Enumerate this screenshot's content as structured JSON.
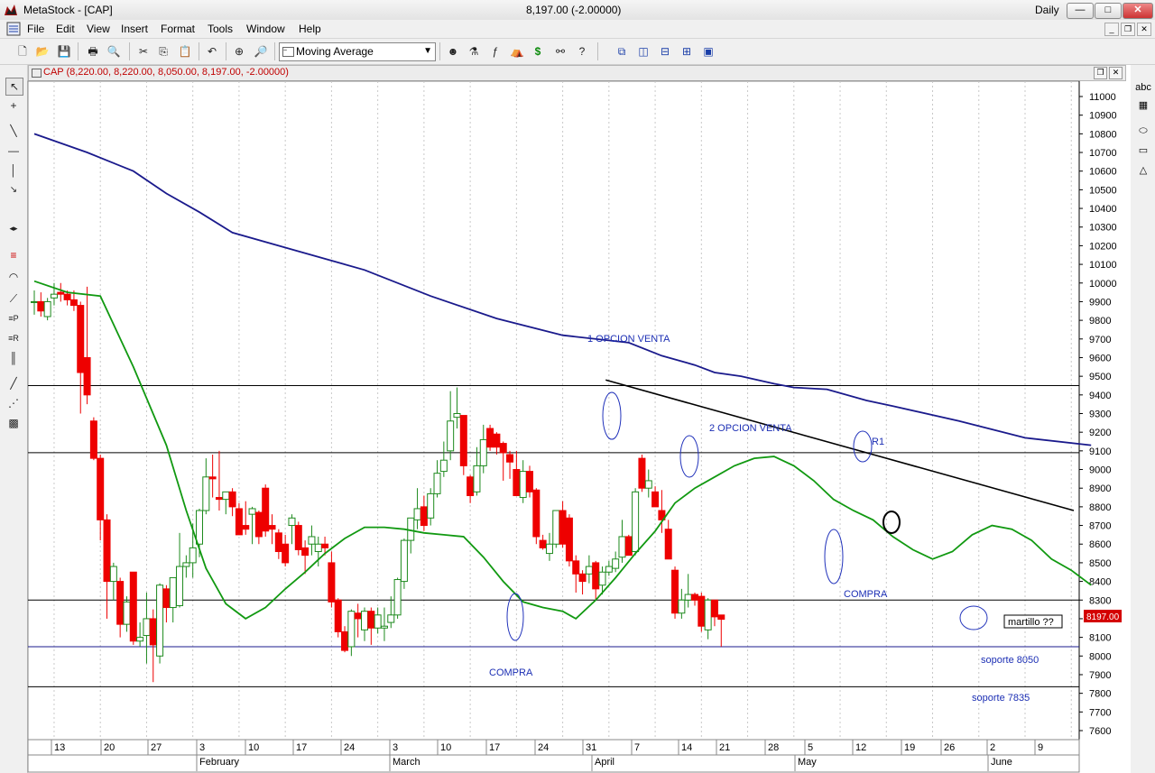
{
  "window": {
    "app_title": "MetaStock - [CAP]",
    "center_text": "8,197.00 (-2.00000)",
    "period": "Daily"
  },
  "menu": [
    "File",
    "Edit",
    "View",
    "Insert",
    "Format",
    "Tools",
    "Window",
    "Help"
  ],
  "toolbar": {
    "indicator_select": "Moving Average"
  },
  "chart_window": {
    "title": "CAP (8,220.00, 8,220.00, 8,050.00, 8,197.00, -2.00000)"
  },
  "chart_data": {
    "type": "candlestick",
    "title": "CAP",
    "y_ticks": [
      11000,
      10900,
      10800,
      10700,
      10600,
      10500,
      10400,
      10300,
      10200,
      10100,
      10000,
      9900,
      9800,
      9700,
      9600,
      9500,
      9400,
      9300,
      9200,
      9100,
      9000,
      8900,
      8800,
      8700,
      8600,
      8500,
      8400,
      8300,
      8200,
      8100,
      8000,
      7900,
      7800,
      7700,
      7600
    ],
    "ylim": [
      7550,
      11050
    ],
    "x_day_ticks": [
      "13",
      "20",
      "27",
      "3",
      "10",
      "17",
      "24",
      "3",
      "10",
      "17",
      "24",
      "31",
      "7",
      "14",
      "21",
      "28",
      "5",
      "12",
      "19",
      "26",
      "2",
      "9"
    ],
    "x_months": [
      "February",
      "March",
      "April",
      "May",
      "June"
    ],
    "last_price_label": "8197.00",
    "ohlc": [
      [
        9900,
        9960,
        9830,
        9900
      ],
      [
        9900,
        9950,
        9820,
        9850
      ],
      [
        9820,
        9920,
        9800,
        9900
      ],
      [
        9920,
        10000,
        9880,
        9940
      ],
      [
        9950,
        10000,
        9900,
        9940
      ],
      [
        9940,
        9960,
        9880,
        9910
      ],
      [
        9910,
        9960,
        9850,
        9880
      ],
      [
        9880,
        9900,
        9300,
        9520
      ],
      [
        9600,
        9980,
        9350,
        9400
      ],
      [
        9260,
        9280,
        9050,
        9060
      ],
      [
        9060,
        9080,
        8620,
        8730
      ],
      [
        8730,
        8760,
        8200,
        8400
      ],
      [
        8400,
        8500,
        8300,
        8480
      ],
      [
        8400,
        8420,
        8100,
        8170
      ],
      [
        8170,
        8320,
        8130,
        8290
      ],
      [
        8450,
        8450,
        8060,
        8080
      ],
      [
        8080,
        8180,
        8050,
        8100
      ],
      [
        8110,
        8340,
        7960,
        8200
      ],
      [
        8200,
        8250,
        7860,
        8060
      ],
      [
        8000,
        8390,
        7960,
        8380
      ],
      [
        8360,
        8380,
        8180,
        8260
      ],
      [
        8260,
        8380,
        8180,
        8420
      ],
      [
        8270,
        8660,
        8260,
        8480
      ],
      [
        8480,
        8540,
        8420,
        8500
      ],
      [
        8500,
        8710,
        8420,
        8580
      ],
      [
        8600,
        8790,
        8530,
        8780
      ],
      [
        8780,
        9060,
        8760,
        8960
      ],
      [
        8960,
        9080,
        8850,
        8950
      ],
      [
        8850,
        9100,
        8780,
        8840
      ],
      [
        8840,
        8880,
        8760,
        8880
      ],
      [
        8880,
        8900,
        8750,
        8800
      ],
      [
        8790,
        8820,
        8680,
        8650
      ],
      [
        8700,
        8830,
        8650,
        8680
      ],
      [
        8760,
        8800,
        8600,
        8790
      ],
      [
        8770,
        8780,
        8600,
        8640
      ],
      [
        8900,
        8920,
        8640,
        8670
      ],
      [
        8700,
        8760,
        8600,
        8680
      ],
      [
        8660,
        8680,
        8520,
        8560
      ],
      [
        8600,
        8650,
        8480,
        8500
      ],
      [
        8700,
        8760,
        8600,
        8740
      ],
      [
        8700,
        8720,
        8540,
        8570
      ],
      [
        8580,
        8620,
        8440,
        8540
      ],
      [
        8600,
        8700,
        8540,
        8640
      ],
      [
        8560,
        8640,
        8480,
        8600
      ],
      [
        8600,
        8640,
        8540,
        8580
      ],
      [
        8500,
        8560,
        8260,
        8290
      ],
      [
        8300,
        8310,
        8100,
        8130
      ],
      [
        8130,
        8160,
        8020,
        8030
      ],
      [
        8050,
        8250,
        8000,
        8240
      ],
      [
        8230,
        8280,
        8100,
        8200
      ],
      [
        8140,
        8260,
        8080,
        8240
      ],
      [
        8240,
        8260,
        8060,
        8150
      ],
      [
        8150,
        8260,
        8120,
        8220
      ],
      [
        8150,
        8260,
        8080,
        8160
      ],
      [
        8180,
        8320,
        8150,
        8220
      ],
      [
        8220,
        8420,
        8200,
        8410
      ],
      [
        8400,
        8630,
        8360,
        8620
      ],
      [
        8620,
        8740,
        8550,
        8740
      ],
      [
        8730,
        8900,
        8680,
        8790
      ],
      [
        8800,
        8860,
        8670,
        8700
      ],
      [
        8740,
        8900,
        8700,
        8870
      ],
      [
        8870,
        9050,
        8850,
        8980
      ],
      [
        8990,
        9150,
        8960,
        9050
      ],
      [
        9100,
        9420,
        9050,
        9260
      ],
      [
        9280,
        9440,
        9220,
        9300
      ],
      [
        9290,
        9290,
        8970,
        9020
      ],
      [
        8960,
        8970,
        8820,
        8860
      ],
      [
        8880,
        9120,
        8860,
        9020
      ],
      [
        9020,
        9240,
        8980,
        9160
      ],
      [
        9220,
        9240,
        9100,
        9120
      ],
      [
        9190,
        9200,
        9080,
        9120
      ],
      [
        9140,
        9150,
        8940,
        9090
      ],
      [
        9080,
        9100,
        8950,
        9040
      ],
      [
        9000,
        9100,
        8860,
        8860
      ],
      [
        8850,
        9050,
        8820,
        8990
      ],
      [
        8990,
        9020,
        8850,
        8880
      ],
      [
        8890,
        8900,
        8600,
        8640
      ],
      [
        8620,
        8650,
        8570,
        8580
      ],
      [
        8550,
        8660,
        8510,
        8600
      ],
      [
        8600,
        8740,
        8580,
        8780
      ],
      [
        8780,
        8830,
        8580,
        8600
      ],
      [
        8740,
        8760,
        8480,
        8510
      ],
      [
        8510,
        8540,
        8340,
        8440
      ],
      [
        8440,
        8460,
        8330,
        8400
      ],
      [
        8440,
        8540,
        8390,
        8480
      ],
      [
        8500,
        8510,
        8300,
        8360
      ],
      [
        8380,
        8480,
        8330,
        8450
      ],
      [
        8450,
        8510,
        8430,
        8480
      ],
      [
        8470,
        8560,
        8450,
        8520
      ],
      [
        8530,
        8730,
        8500,
        8640
      ],
      [
        8640,
        8650,
        8550,
        8540
      ],
      [
        8560,
        8900,
        8540,
        8880
      ],
      [
        9060,
        9080,
        8880,
        8900
      ],
      [
        8900,
        9000,
        8850,
        8940
      ],
      [
        8880,
        8910,
        8810,
        8800
      ],
      [
        8780,
        8890,
        8660,
        8730
      ],
      [
        8680,
        8730,
        8580,
        8520
      ],
      [
        8460,
        8480,
        8200,
        8230
      ],
      [
        8230,
        8360,
        8200,
        8300
      ],
      [
        8300,
        8440,
        8260,
        8330
      ],
      [
        8330,
        8340,
        8270,
        8300
      ],
      [
        8320,
        8340,
        8130,
        8160
      ],
      [
        8140,
        8310,
        8090,
        8300
      ],
      [
        8300,
        8300,
        8160,
        8210
      ],
      [
        8220,
        8220,
        8050,
        8197
      ]
    ],
    "series": [
      {
        "name": "",
        "color": "#1a1a8c",
        "kind": "ma-long",
        "points": [
          [
            0,
            10800
          ],
          [
            8,
            10700
          ],
          [
            15,
            10600
          ],
          [
            20,
            10480
          ],
          [
            25,
            10380
          ],
          [
            30,
            10270
          ],
          [
            40,
            10170
          ],
          [
            50,
            10070
          ],
          [
            60,
            9930
          ],
          [
            70,
            9810
          ],
          [
            80,
            9720
          ],
          [
            90,
            9680
          ],
          [
            95,
            9610
          ],
          [
            100,
            9560
          ],
          [
            103,
            9520
          ],
          [
            107,
            9500
          ],
          [
            112,
            9460
          ],
          [
            115,
            9440
          ],
          [
            120,
            9430
          ],
          [
            126,
            9370
          ],
          [
            130,
            9340
          ],
          [
            140,
            9260
          ],
          [
            150,
            9170
          ],
          [
            160,
            9130
          ]
        ]
      }
    ],
    "ma_short": [
      [
        0,
        10010
      ],
      [
        5,
        9950
      ],
      [
        10,
        9930
      ],
      [
        15,
        9550
      ],
      [
        20,
        9130
      ],
      [
        23,
        8780
      ],
      [
        26,
        8470
      ],
      [
        29,
        8280
      ],
      [
        32,
        8200
      ],
      [
        35,
        8260
      ],
      [
        38,
        8360
      ],
      [
        41,
        8450
      ],
      [
        44,
        8550
      ],
      [
        47,
        8630
      ],
      [
        50,
        8690
      ],
      [
        53,
        8690
      ],
      [
        56,
        8680
      ],
      [
        59,
        8660
      ],
      [
        62,
        8650
      ],
      [
        65,
        8640
      ],
      [
        68,
        8530
      ],
      [
        71,
        8400
      ],
      [
        74,
        8290
      ],
      [
        77,
        8260
      ],
      [
        80,
        8240
      ],
      [
        82,
        8200
      ],
      [
        85,
        8300
      ],
      [
        88,
        8420
      ],
      [
        91,
        8550
      ],
      [
        94,
        8670
      ],
      [
        97,
        8820
      ],
      [
        100,
        8900
      ],
      [
        103,
        8960
      ],
      [
        106,
        9020
      ],
      [
        109,
        9060
      ],
      [
        112,
        9070
      ],
      [
        115,
        9020
      ],
      [
        118,
        8940
      ],
      [
        121,
        8840
      ],
      [
        124,
        8780
      ],
      [
        127,
        8730
      ],
      [
        130,
        8640
      ],
      [
        133,
        8570
      ],
      [
        136,
        8520
      ],
      [
        139,
        8560
      ],
      [
        142,
        8650
      ],
      [
        145,
        8700
      ],
      [
        148,
        8680
      ],
      [
        151,
        8620
      ],
      [
        154,
        8520
      ],
      [
        157,
        8460
      ],
      [
        160,
        8380
      ]
    ],
    "horizontal_lines": [
      9450,
      9090,
      8300,
      8050,
      7835
    ],
    "trendline": [
      [
        107,
        9480
      ],
      [
        196,
        8780
      ]
    ],
    "annotations": [
      {
        "text": "1 OPCION VENTA"
      },
      {
        "text": "2 OPCION VENTA"
      },
      {
        "text": "R1"
      },
      {
        "text": "COMPRA"
      },
      {
        "text": "COMPRA"
      },
      {
        "text": "soporte 8050"
      },
      {
        "text": "soporte 7835"
      },
      {
        "text": "martillo ??"
      }
    ]
  },
  "right_tools": {
    "text_tool": "abc"
  }
}
